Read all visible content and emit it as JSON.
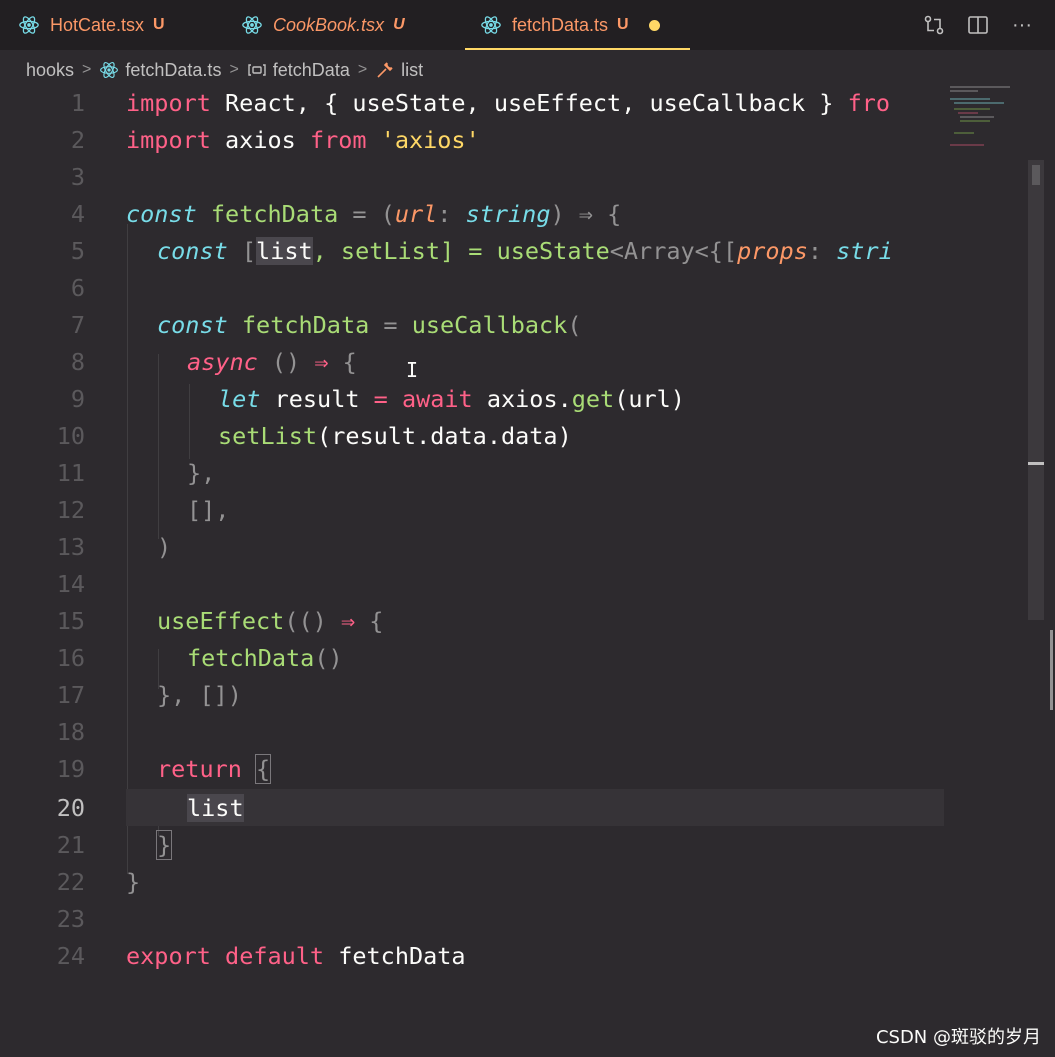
{
  "tabs": [
    {
      "label": "HotCate.tsx",
      "status": "U"
    },
    {
      "label": "CookBook.tsx",
      "status": "U"
    },
    {
      "label": "fetchData.ts",
      "status": "U"
    }
  ],
  "toolbar": {
    "icons": [
      "source-control-compare-icon",
      "split-editor-icon",
      "more-actions-icon"
    ],
    "more_label": "···"
  },
  "breadcrumb": {
    "folder": "hooks",
    "file": "fetchData.ts",
    "symbol": "fetchData",
    "variable": "list"
  },
  "editor": {
    "current_line": 20,
    "line_numbers": [
      "1",
      "2",
      "3",
      "4",
      "5",
      "6",
      "7",
      "8",
      "9",
      "10",
      "11",
      "12",
      "13",
      "14",
      "15",
      "16",
      "17",
      "18",
      "19",
      "20",
      "21",
      "22",
      "23",
      "24"
    ],
    "l1": {
      "a": "import",
      "b": " React, { useState, useEffect, useCallback } ",
      "c": "fro"
    },
    "l2": {
      "a": "import",
      "b": " axios ",
      "c": "from",
      "d": " ",
      "e": "'axios'"
    },
    "l4": {
      "a": "const",
      "b": " ",
      "c": "fetchData",
      "d": " = (",
      "e": "url",
      "f": ": ",
      "g": "string",
      "h": ") ⇒ {"
    },
    "l5": {
      "a": "const",
      "b": " [",
      "c": "list",
      "d": ", setList] = ",
      "e": "useState",
      "f": "<Array<{[",
      "g": "props",
      "h": ": ",
      "i": "stri"
    },
    "l7": {
      "a": "const",
      "b": " ",
      "c": "fetchData",
      "d": " = ",
      "e": "useCallback",
      "f": "("
    },
    "l8": {
      "a": "async",
      "b": " () ",
      "c": "⇒",
      "d": " {"
    },
    "l9": {
      "a": "let",
      "b": " result ",
      "c": "=",
      "d": " ",
      "e": "await",
      "f": " axios.",
      "g": "get",
      "h": "(url)"
    },
    "l10": {
      "a": "setList",
      "b": "(result.data.data)"
    },
    "l11": {
      "a": "},"
    },
    "l12": {
      "a": "[],"
    },
    "l13": {
      "a": ")"
    },
    "l15": {
      "a": "useEffect",
      "b": "(() ",
      "c": "⇒",
      "d": " {"
    },
    "l16": {
      "a": "fetchData",
      "b": "()"
    },
    "l17": {
      "a": "}, [])"
    },
    "l19": {
      "a": "return",
      "b": " ",
      "c": "{"
    },
    "l20": {
      "a": "list"
    },
    "l21": {
      "a": "}"
    },
    "l22": {
      "a": "}"
    },
    "l24": {
      "a": "export",
      "b": " ",
      "c": "default",
      "d": " fetchData"
    }
  },
  "watermark": "CSDN @斑驳的岁月",
  "colors": {
    "background": "#2d2a2e",
    "keyword": "#ff6188",
    "storage": "#78dce8",
    "function": "#a9dc76",
    "string": "#ffd866",
    "parameter": "#fc9867",
    "modified_dot": "#ffd866"
  }
}
